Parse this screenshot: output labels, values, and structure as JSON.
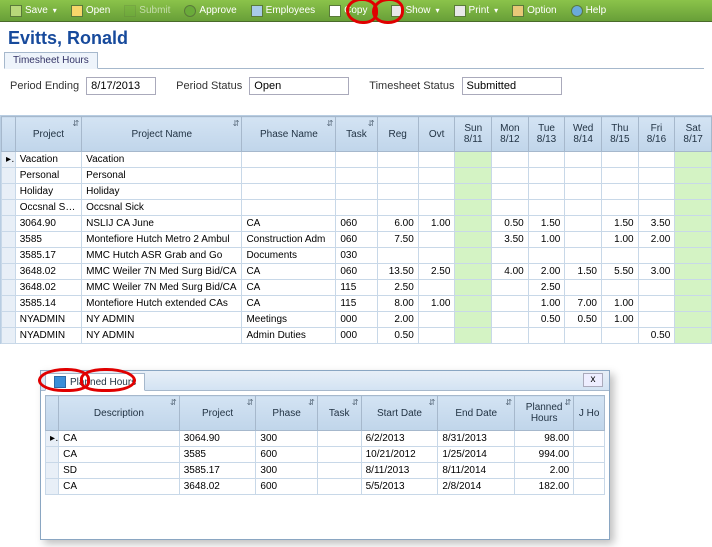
{
  "toolbar": {
    "save": "Save",
    "open": "Open",
    "submit": "Submit",
    "approve": "Approve",
    "employees": "Employees",
    "copy": "Copy",
    "show": "Show",
    "print": "Print",
    "option": "Option",
    "help": "Help"
  },
  "user_name": "Evitts, Ronald",
  "tabs": {
    "timesheet": "Timesheet Hours"
  },
  "fields": {
    "period_ending_label": "Period Ending",
    "period_ending_value": "8/17/2013",
    "period_status_label": "Period Status",
    "period_status_value": "Open",
    "timesheet_status_label": "Timesheet Status",
    "timesheet_status_value": "Submitted"
  },
  "grid": {
    "headers": {
      "project": "Project",
      "project_name": "Project Name",
      "phase_name": "Phase Name",
      "task": "Task",
      "reg": "Reg",
      "ovt": "Ovt",
      "days": [
        "Sun 8/11",
        "Mon 8/12",
        "Tue 8/13",
        "Wed 8/14",
        "Thu 8/15",
        "Fri 8/16",
        "Sat 8/17"
      ]
    },
    "rows": [
      {
        "project": "Vacation",
        "pname": "Vacation",
        "phase": "",
        "task": "",
        "reg": "",
        "ovt": "",
        "days": [
          "",
          "",
          "",
          "",
          "",
          "",
          ""
        ]
      },
      {
        "project": "Personal",
        "pname": "Personal",
        "phase": "",
        "task": "",
        "reg": "",
        "ovt": "",
        "days": [
          "",
          "",
          "",
          "",
          "",
          "",
          ""
        ]
      },
      {
        "project": "Holiday",
        "pname": "Holiday",
        "phase": "",
        "task": "",
        "reg": "",
        "ovt": "",
        "days": [
          "",
          "",
          "",
          "",
          "",
          "",
          ""
        ]
      },
      {
        "project": "Occsnal Sick",
        "pname": "Occsnal Sick",
        "phase": "",
        "task": "",
        "reg": "",
        "ovt": "",
        "days": [
          "",
          "",
          "",
          "",
          "",
          "",
          ""
        ]
      },
      {
        "project": "3064.90",
        "pname": "NSLIJ CA June",
        "phase": "CA",
        "task": "060",
        "reg": "6.00",
        "ovt": "1.00",
        "days": [
          "",
          "0.50",
          "1.50",
          "",
          "1.50",
          "3.50",
          ""
        ]
      },
      {
        "project": "3585",
        "pname": "Montefiore Hutch Metro 2 Ambul",
        "phase": "Construction Adm",
        "task": "060",
        "reg": "7.50",
        "ovt": "",
        "days": [
          "",
          "3.50",
          "1.00",
          "",
          "1.00",
          "2.00",
          ""
        ]
      },
      {
        "project": "3585.17",
        "pname": "MMC Hutch ASR Grab and Go",
        "phase": "Documents",
        "task": "030",
        "reg": "",
        "ovt": "",
        "days": [
          "",
          "",
          "",
          "",
          "",
          "",
          ""
        ]
      },
      {
        "project": "3648.02",
        "pname": "MMC Weiler 7N Med Surg Bid/CA",
        "phase": "CA",
        "task": "060",
        "reg": "13.50",
        "ovt": "2.50",
        "days": [
          "",
          "4.00",
          "2.00",
          "1.50",
          "5.50",
          "3.00",
          ""
        ]
      },
      {
        "project": "3648.02",
        "pname": "MMC Weiler 7N Med Surg Bid/CA",
        "phase": "CA",
        "task": "115",
        "reg": "2.50",
        "ovt": "",
        "days": [
          "",
          "",
          "2.50",
          "",
          "",
          "",
          ""
        ]
      },
      {
        "project": "3585.14",
        "pname": "Montefiore Hutch extended CAs",
        "phase": "CA",
        "task": "115",
        "reg": "8.00",
        "ovt": "1.00",
        "days": [
          "",
          "",
          "1.00",
          "7.00",
          "1.00",
          "",
          ""
        ]
      },
      {
        "project": "NYADMIN",
        "pname": "NY ADMIN",
        "phase": "Meetings",
        "task": "000",
        "reg": "2.00",
        "ovt": "",
        "days": [
          "",
          "",
          "0.50",
          "0.50",
          "1.00",
          "",
          ""
        ]
      },
      {
        "project": "NYADMIN",
        "pname": "NY ADMIN",
        "phase": "Admin Duties",
        "task": "000",
        "reg": "0.50",
        "ovt": "",
        "days": [
          "",
          "",
          "",
          "",
          "",
          "0.50",
          ""
        ]
      }
    ]
  },
  "popup": {
    "title": "Planned Hours",
    "close": "x",
    "headers": {
      "description": "Description",
      "project": "Project",
      "phase": "Phase",
      "task": "Task",
      "start": "Start Date",
      "end": "End Date",
      "planned": "Planned Hours",
      "jtd": "J Ho"
    },
    "rows": [
      {
        "desc": "CA",
        "project": "3064.90",
        "phase": "300",
        "task": "",
        "start": "6/2/2013",
        "end": "8/31/2013",
        "planned": "98.00"
      },
      {
        "desc": "CA",
        "project": "3585",
        "phase": "600",
        "task": "",
        "start": "10/21/2012",
        "end": "1/25/2014",
        "planned": "994.00"
      },
      {
        "desc": "SD",
        "project": "3585.17",
        "phase": "300",
        "task": "",
        "start": "8/11/2013",
        "end": "8/11/2014",
        "planned": "2.00"
      },
      {
        "desc": "CA",
        "project": "3648.02",
        "phase": "600",
        "task": "",
        "start": "5/5/2013",
        "end": "2/8/2014",
        "planned": "182.00"
      }
    ]
  },
  "chart_data": {
    "type": "table",
    "title": "Timesheet Hours — Period Ending 8/17/2013",
    "columns": [
      "Project",
      "Project Name",
      "Phase Name",
      "Task",
      "Reg",
      "Ovt",
      "Sun 8/11",
      "Mon 8/12",
      "Tue 8/13",
      "Wed 8/14",
      "Thu 8/15",
      "Fri 8/16",
      "Sat 8/17"
    ],
    "rows": [
      [
        "3064.90",
        "NSLIJ CA June",
        "CA",
        "060",
        6.0,
        1.0,
        null,
        0.5,
        1.5,
        null,
        1.5,
        3.5,
        null
      ],
      [
        "3585",
        "Montefiore Hutch Metro 2 Ambul",
        "Construction Adm",
        "060",
        7.5,
        null,
        null,
        3.5,
        1.0,
        null,
        1.0,
        2.0,
        null
      ],
      [
        "3585.17",
        "MMC Hutch ASR Grab and Go",
        "Documents",
        "030",
        null,
        null,
        null,
        null,
        null,
        null,
        null,
        null,
        null
      ],
      [
        "3648.02",
        "MMC Weiler 7N Med Surg Bid/CA",
        "CA",
        "060",
        13.5,
        2.5,
        null,
        4.0,
        2.0,
        1.5,
        5.5,
        3.0,
        null
      ],
      [
        "3648.02",
        "MMC Weiler 7N Med Surg Bid/CA",
        "CA",
        "115",
        2.5,
        null,
        null,
        null,
        2.5,
        null,
        null,
        null,
        null
      ],
      [
        "3585.14",
        "Montefiore Hutch extended CAs",
        "CA",
        "115",
        8.0,
        1.0,
        null,
        null,
        1.0,
        7.0,
        1.0,
        null,
        null
      ],
      [
        "NYADMIN",
        "NY ADMIN",
        "Meetings",
        "000",
        2.0,
        null,
        null,
        null,
        0.5,
        0.5,
        1.0,
        null,
        null
      ],
      [
        "NYADMIN",
        "NY ADMIN",
        "Admin Duties",
        "000",
        0.5,
        null,
        null,
        null,
        null,
        null,
        null,
        0.5,
        null
      ]
    ]
  }
}
